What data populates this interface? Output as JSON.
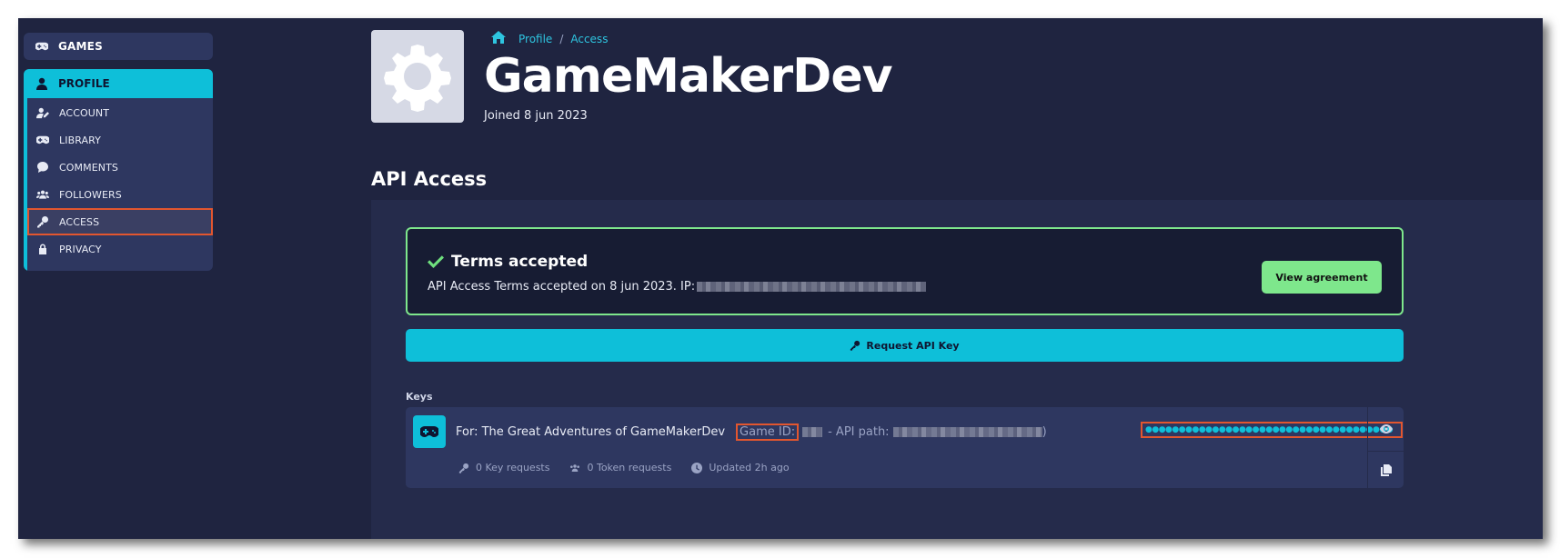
{
  "sidebar": {
    "games_label": "GAMES",
    "profile_label": "PROFILE",
    "items": [
      {
        "label": "ACCOUNT",
        "icon": "user-edit-icon"
      },
      {
        "label": "LIBRARY",
        "icon": "gamepad-icon"
      },
      {
        "label": "COMMENTS",
        "icon": "comment-icon"
      },
      {
        "label": "FOLLOWERS",
        "icon": "users-icon"
      },
      {
        "label": "ACCESS",
        "icon": "key-icon",
        "active": true
      },
      {
        "label": "PRIVACY",
        "icon": "lock-icon"
      }
    ]
  },
  "header": {
    "breadcrumb": [
      "Profile",
      "Access"
    ],
    "breadcrumb_separator": "/",
    "title": "GameMakerDev",
    "joined": "Joined 8 jun 2023"
  },
  "api": {
    "section_title": "API Access",
    "terms_title": "Terms accepted",
    "terms_text": "API Access Terms accepted on 8 jun 2023. IP:",
    "view_agreement": "View agreement",
    "request_button": "Request API Key",
    "keys_label": "Keys",
    "key": {
      "for_text": "For: The Great Adventures of GameMakerDev",
      "game_id_label": "Game ID:",
      "api_path_label": "- API path:",
      "closing_paren": ")",
      "secret_masked": "●●●●●●●●●●●●●●●●●●●●●●●●●●●●●●●●●●●●●",
      "key_requests": "0 Key requests",
      "token_requests": "0 Token requests",
      "updated": "Updated 2h ago"
    }
  },
  "colors": {
    "accent": "#0ebfd9",
    "success": "#7ee78c",
    "background": "#1f2440",
    "panel": "#2e3760",
    "highlight": "#e2562f"
  }
}
